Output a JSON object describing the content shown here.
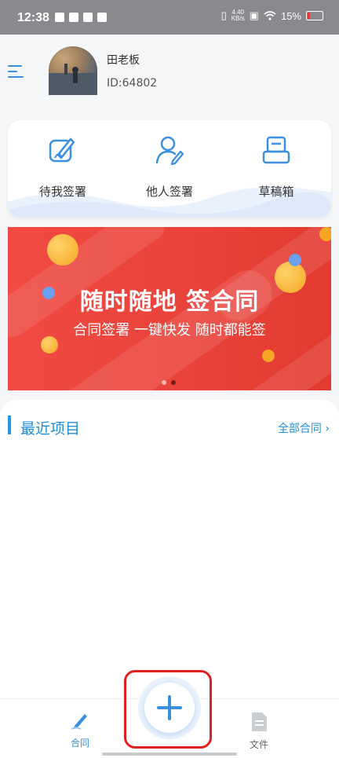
{
  "status_bar": {
    "time": "12:38",
    "net_speed_value": "4.40",
    "net_speed_unit": "KB/s",
    "battery": "15%"
  },
  "profile": {
    "name": "田老板",
    "id": "ID:64802"
  },
  "sign_actions": [
    {
      "label": "待我签署",
      "icon": "pen-sign-icon"
    },
    {
      "label": "他人签署",
      "icon": "person-edit-icon"
    },
    {
      "label": "草稿箱",
      "icon": "drafts-tray-icon"
    }
  ],
  "banner": {
    "title": "随时随地 签合同",
    "subtitle": "合同签署  一键快发  随时都能签",
    "slides": 2,
    "active_slide": 2,
    "background_color": "#ee443c"
  },
  "recent": {
    "title": "最近项目",
    "all_link": "全部合同"
  },
  "tab_bar": {
    "contract": "合同",
    "files": "文件",
    "add_icon": "plus-icon"
  },
  "colors": {
    "accent": "#1f8fd8",
    "icon_blue": "#3b8fe0",
    "highlight_red": "#e02020"
  }
}
